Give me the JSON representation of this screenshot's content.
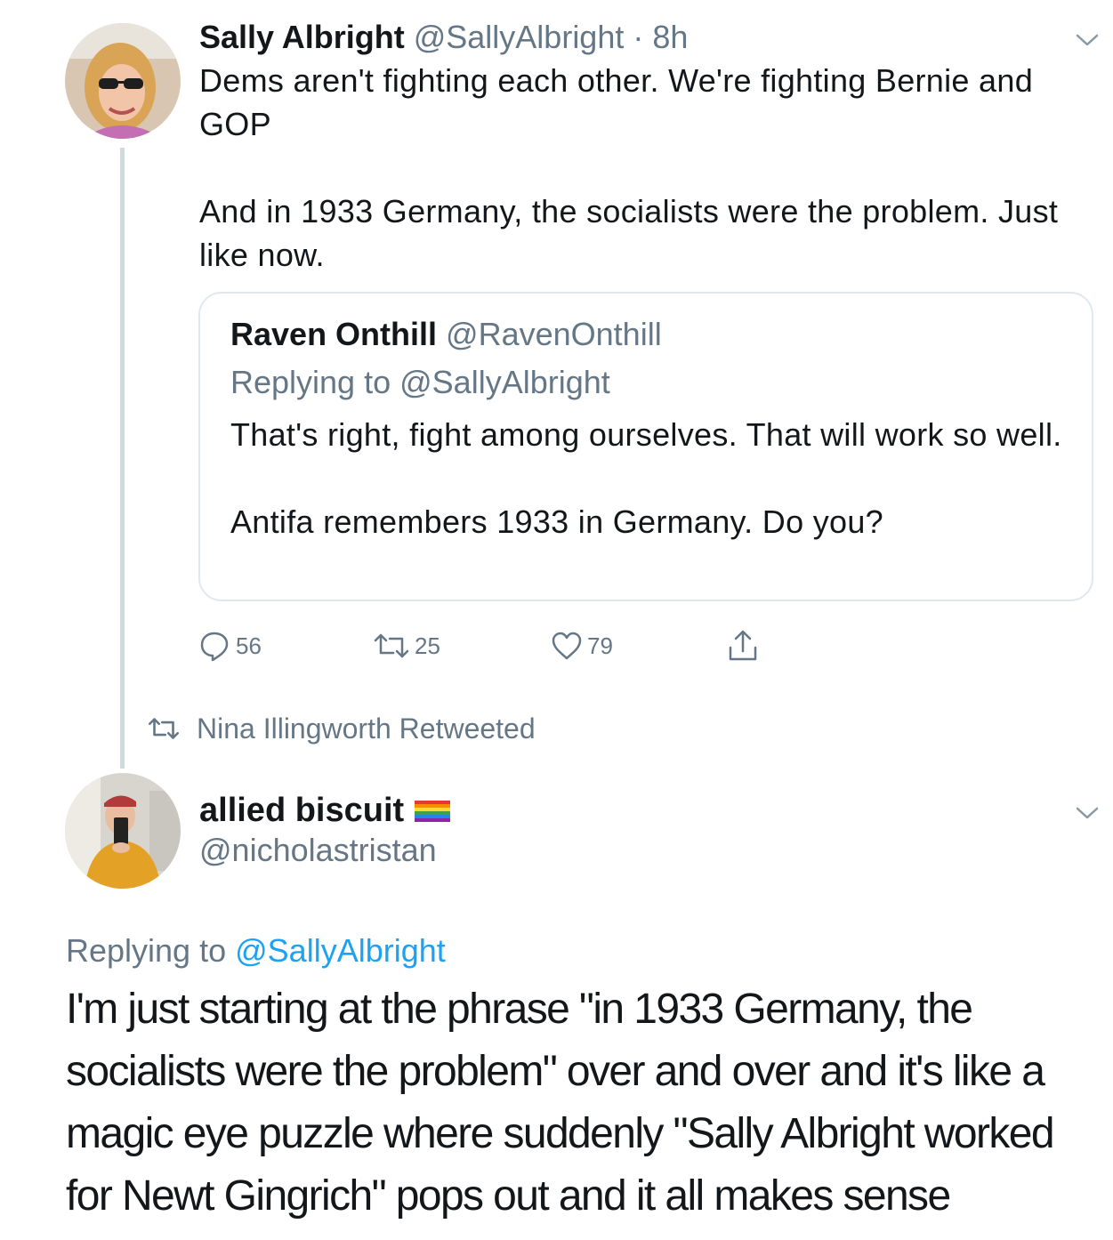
{
  "tweet1": {
    "display_name": "Sally Albright",
    "handle": "@SallyAlbright",
    "separator": "·",
    "time": "8h",
    "text_line1": "Dems aren't fighting each other. We're fighting Bernie and GOP",
    "text_line2": "And in 1933 Germany, the socialists were the problem. Just like now.",
    "menu_icon": "chevron-down-icon"
  },
  "quoted": {
    "display_name": "Raven Onthill",
    "handle": "@RavenOnthill",
    "replying_prefix": "Replying to",
    "replying_to": "@SallyAlbright",
    "text_line1": "That's right, fight among ourselves. That will work so well.",
    "text_line2": "Antifa remembers 1933 in Germany. Do you?"
  },
  "actions": {
    "replies": "56",
    "retweets": "25",
    "likes": "79",
    "icons": [
      "reply-icon",
      "retweet-icon",
      "like-icon",
      "share-icon"
    ]
  },
  "retweet_context": {
    "text": "Nina Illingworth Retweeted",
    "icon": "retweet-icon"
  },
  "tweet2": {
    "display_name": "allied biscuit",
    "name_emoji": "rainbow-flag-icon",
    "handle": "@nicholastristan",
    "replying_prefix": "Replying to",
    "replying_to": "@SallyAlbright",
    "text": "I'm just starting at the phrase \"in 1933 Germany, the socialists were the problem\" over and over and it's like a magic eye puzzle where suddenly \"Sally Albright worked for Newt Gingrich\" pops out and it all makes sense",
    "menu_icon": "chevron-down-icon"
  },
  "colors": {
    "text": "#14171a",
    "muted": "#657786",
    "link": "#1da1f2",
    "border": "#e1e8ed"
  }
}
